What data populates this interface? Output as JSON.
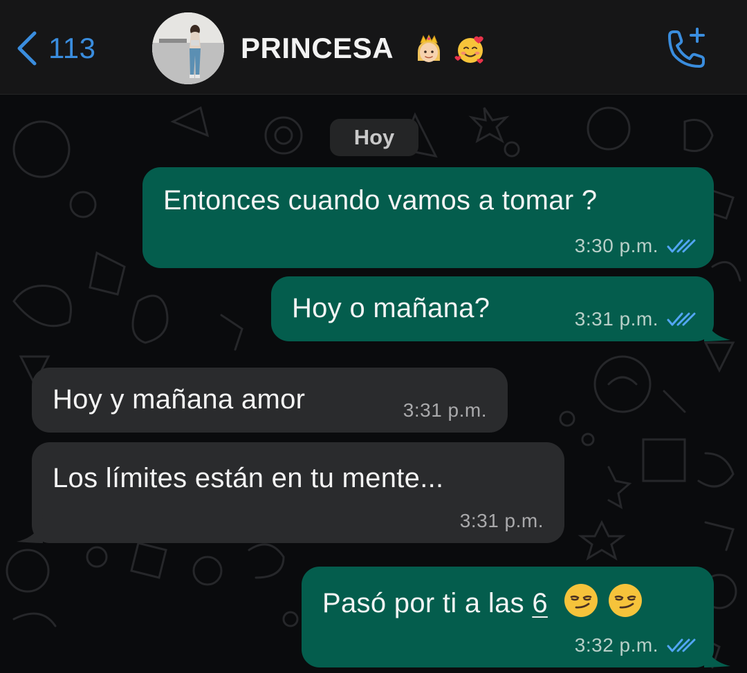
{
  "header": {
    "back_count": "113",
    "contact_name": "PRINCESA",
    "name_emojis": [
      "princess-emoji",
      "smiling-face-with-hearts-emoji"
    ],
    "call_icon": "add-call-icon"
  },
  "chat": {
    "date_separator": "Hoy",
    "messages": [
      {
        "direction": "outgoing",
        "text": "Entonces cuando vamos a tomar ?",
        "time": "3:30 p.m.",
        "status": "read"
      },
      {
        "direction": "outgoing",
        "text": "Hoy o mañana?",
        "time": "3:31 p.m.",
        "status": "read"
      },
      {
        "direction": "incoming",
        "text": "Hoy y mañana amor",
        "time": "3:31 p.m."
      },
      {
        "direction": "incoming",
        "text": "Los límites están en tu mente...",
        "time": "3:31 p.m."
      },
      {
        "direction": "outgoing",
        "text_before": "Pasó por ti a las ",
        "text_underlined": "6",
        "emojis": [
          "smirking-face-emoji",
          "smirking-face-emoji"
        ],
        "time": "3:32 p.m.",
        "status": "read"
      }
    ]
  },
  "colors": {
    "accent_blue": "#3a8dde",
    "outgoing_bubble": "#045d4d",
    "incoming_bubble": "#2a2b2d",
    "read_tick": "#53a6f5"
  }
}
